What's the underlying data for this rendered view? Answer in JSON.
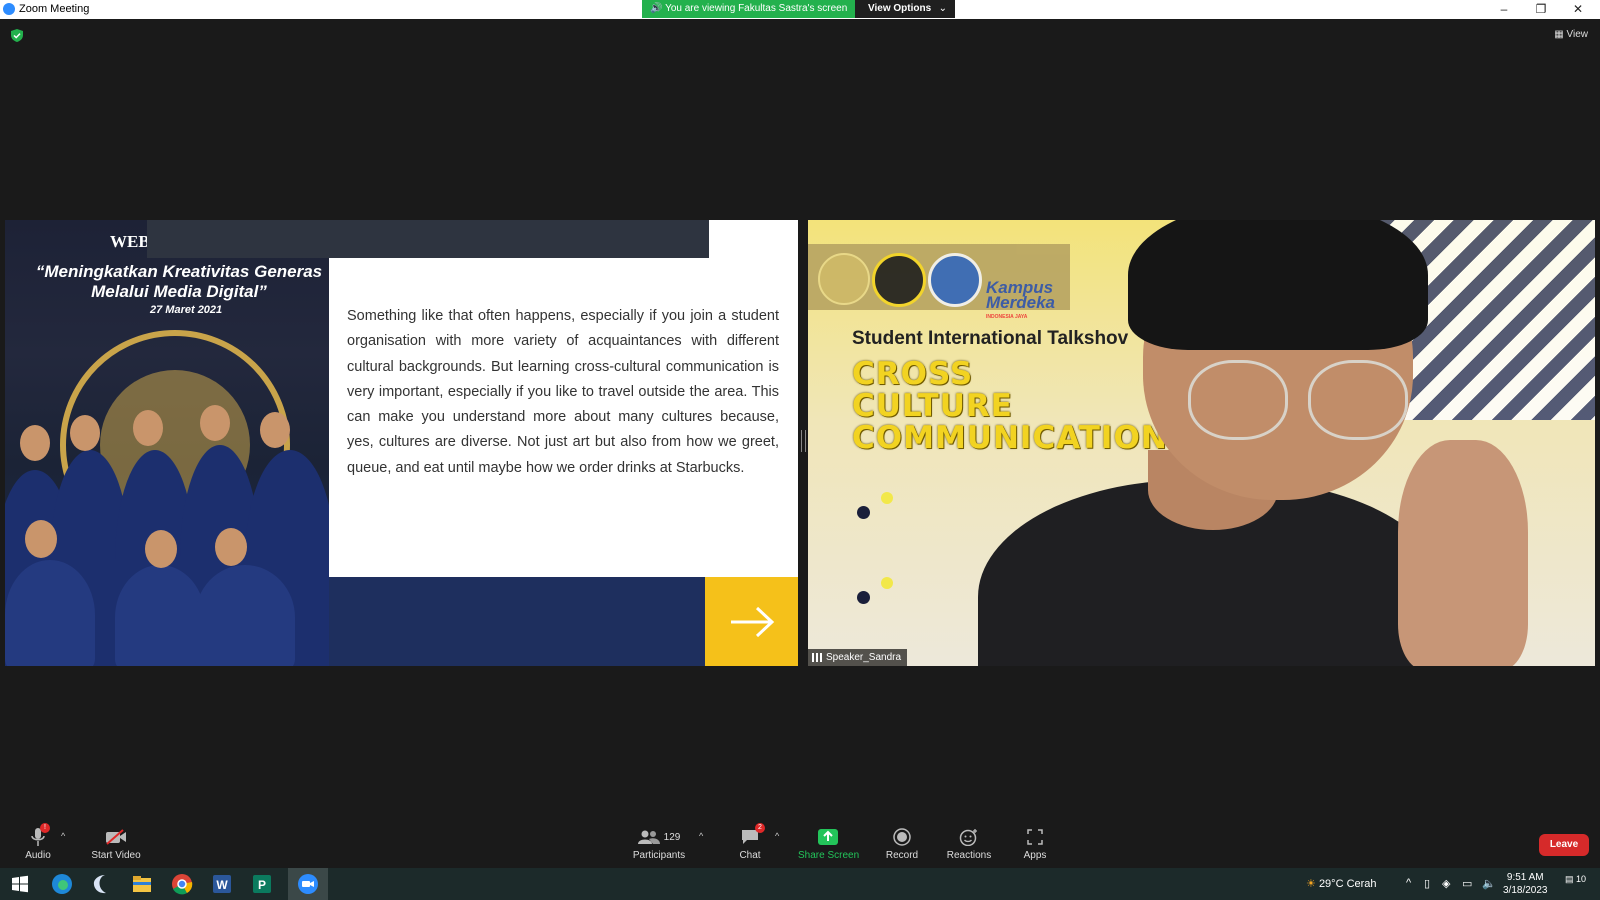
{
  "window": {
    "title": "Zoom Meeting",
    "share_banner": "You are viewing Fakultas Sastra's screen",
    "view_options": "View Options"
  },
  "meeting": {
    "view_label": "View"
  },
  "slide": {
    "web_label": "WEB",
    "quote_line1": "“Meningkatkan Kreativitas Generas",
    "quote_line2": "Melalui Media Digital”",
    "date": "27 Maret 2021",
    "body": "Something like that often happens, especially if you join a student organisation with more variety of acquaintances with different cultural backgrounds. But learning cross-cultural communication is very important, especially if you like to travel outside the area. This can make you understand more about many cultures because, yes, cultures are diverse. Not just art but also from how we greet, queue, and eat until maybe how we order drinks at Starbucks."
  },
  "speaker": {
    "kampus": "Kampus",
    "merdeka": "Merdeka",
    "kampus_sub": "INDONESIA JAYA",
    "talkshow": "Student International Talkshov",
    "title_line1": "CROSS",
    "title_line2": "CULTURE",
    "title_line3": "COMMUNICATION",
    "name": "Speaker_Sandra"
  },
  "toolbar": {
    "audio": "Audio",
    "audio_badge": "!",
    "start_video": "Start Video",
    "participants": "Participants",
    "participants_count": "129",
    "chat": "Chat",
    "chat_badge": "2",
    "share_screen": "Share Screen",
    "record": "Record",
    "reactions": "Reactions",
    "apps": "Apps",
    "leave": "Leave"
  },
  "taskbar": {
    "weather": "29°C  Cerah",
    "time": "9:51 AM",
    "date": "3/18/2023",
    "notification_count": "10"
  },
  "colors": {
    "share_green": "#23b14d",
    "leave_red": "#d62a2a",
    "slide_navy": "#1e2f5e",
    "slide_yellow": "#f5c11a"
  }
}
